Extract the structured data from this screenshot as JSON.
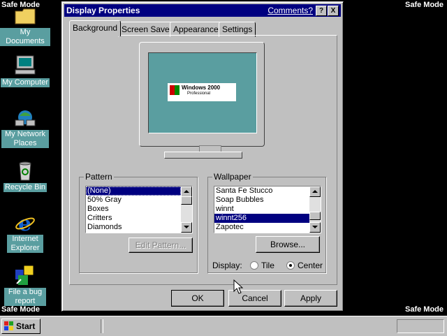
{
  "desktop": {
    "safe_mode": "Safe Mode",
    "icons": [
      {
        "label": "My Documents",
        "icon": "folder-icon"
      },
      {
        "label": "My Computer",
        "icon": "computer-icon"
      },
      {
        "label": "My Network Places",
        "icon": "network-icon"
      },
      {
        "label": "Recycle Bin",
        "icon": "recycle-bin-icon"
      },
      {
        "label": "Internet Explorer",
        "icon": "internet-explorer-icon"
      },
      {
        "label": "File a bug report",
        "icon": "bug-report-icon"
      }
    ],
    "colors": {
      "background": "#000000",
      "label_bg": "#5a9ea0",
      "titlebar": "#000080"
    }
  },
  "dialog": {
    "title": "Display Properties",
    "comments": "Comments?",
    "help": "?",
    "close": "X",
    "tabs": [
      "Background",
      "Screen Saver",
      "Appearance",
      "Settings"
    ],
    "active_tab": "Background",
    "preview": {
      "logo_text": "Windows 2000",
      "logo_sub": "Professional"
    },
    "pattern": {
      "label": "Pattern",
      "items": [
        "(None)",
        "50% Gray",
        "Boxes",
        "Critters",
        "Diamonds"
      ],
      "selected": "(None)",
      "edit_button": "Edit Pattern..."
    },
    "wallpaper": {
      "label": "Wallpaper",
      "items": [
        "Santa Fe Stucco",
        "Soap Bubbles",
        "winnt",
        "winnt256",
        "Zapotec"
      ],
      "selected": "winnt256",
      "browse_button": "Browse...",
      "display_label": "Display:",
      "display_options": [
        "Tile",
        "Center"
      ],
      "display_selected": "Center"
    },
    "buttons": {
      "ok": "OK",
      "cancel": "Cancel",
      "apply": "Apply"
    }
  },
  "taskbar": {
    "start": "Start"
  }
}
